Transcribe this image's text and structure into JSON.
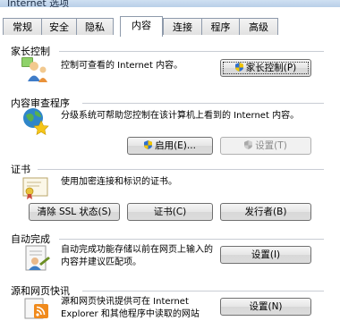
{
  "window": {
    "title": "Internet 选项"
  },
  "tabs": [
    {
      "label": "常规"
    },
    {
      "label": "安全"
    },
    {
      "label": "隐私"
    },
    {
      "label": "内容"
    },
    {
      "label": "连接"
    },
    {
      "label": "程序"
    },
    {
      "label": "高级"
    }
  ],
  "active_tab": "内容",
  "parental": {
    "title": "家长控制",
    "desc": "控制可查看的 Internet 内容。",
    "button": "家长控制(P)"
  },
  "advisor": {
    "title": "内容审查程序",
    "desc": "分级系统可帮助您控制在该计算机上看到的 Internet 内容。",
    "enable_button": "启用(E)...",
    "settings_button": "设置(T)"
  },
  "certificates": {
    "title": "证书",
    "desc": "使用加密连接和标识的证书。",
    "clear_ssl_button": "清除 SSL 状态(S)",
    "certs_button": "证书(C)",
    "publishers_button": "发行者(B)"
  },
  "autocomplete": {
    "title": "自动完成",
    "desc": "自动完成功能存储以前在网页上输入的内容并建议匹配项。",
    "settings_button": "设置(I)"
  },
  "feeds": {
    "title": "源和网页快讯",
    "desc": "源和网页快讯提供可在 Internet Explorer 和其他程序中读取的网站",
    "settings_button": "设置(N)"
  },
  "colors": {
    "tab_border": "#8e9aab",
    "divider": "#c9cdd4",
    "shield_blue": "#2f6fd0",
    "shield_yellow": "#f2c500"
  }
}
